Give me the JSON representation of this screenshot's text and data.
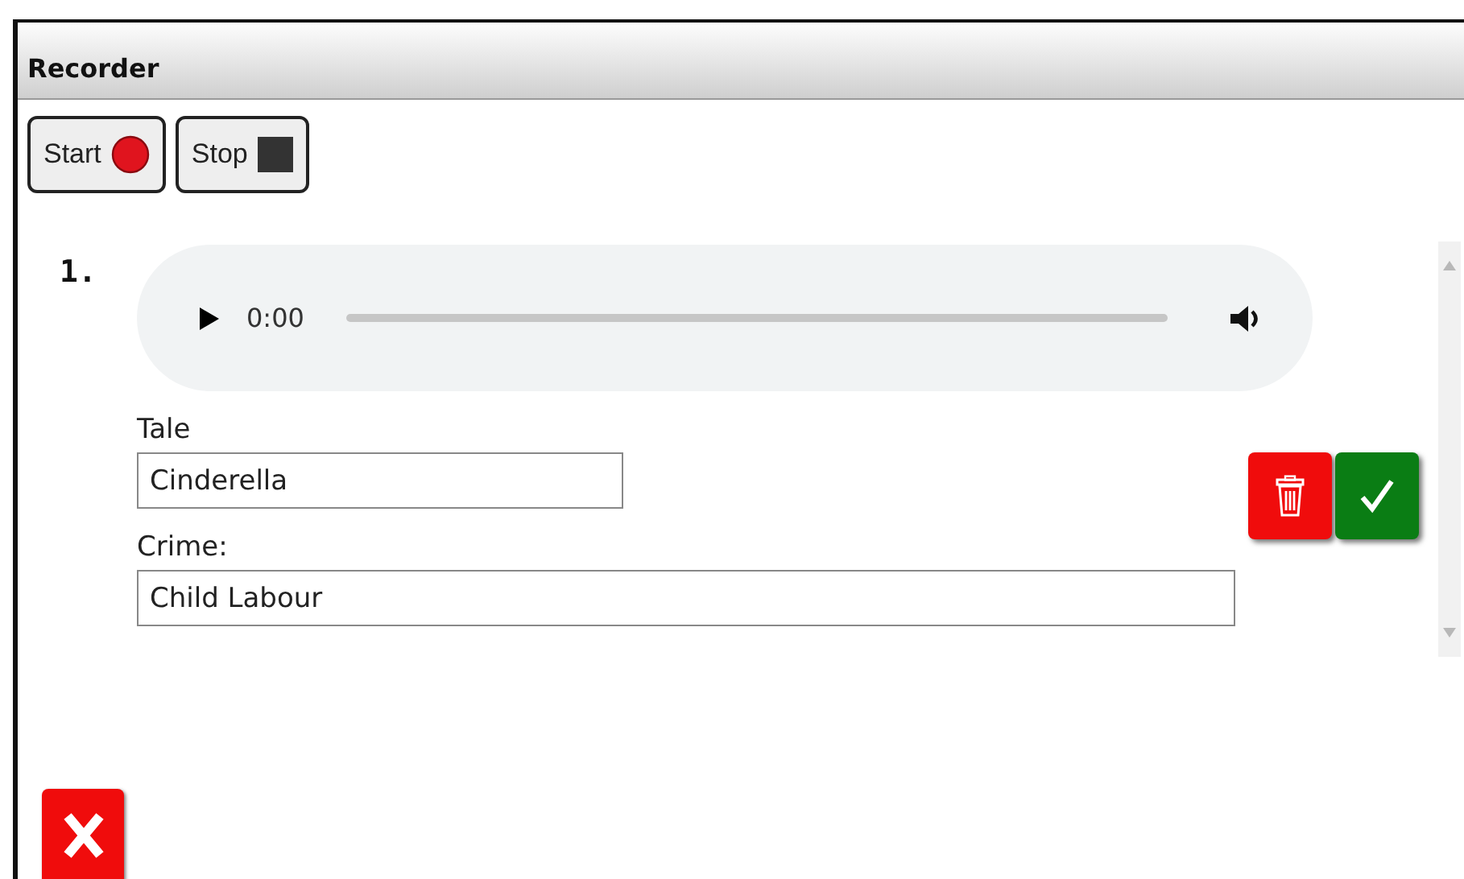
{
  "window": {
    "title": "Recorder"
  },
  "toolbar": [
    {
      "label": "Start",
      "kind": "record"
    },
    {
      "label": "Stop",
      "kind": "stop"
    }
  ],
  "recordings": [
    {
      "number": "1.",
      "player": {
        "time": "0:00"
      },
      "fields": [
        {
          "label": "Tale",
          "value": "Cinderella",
          "kind": "short"
        },
        {
          "label": "Crime:",
          "value": "Child Labour",
          "kind": "long"
        }
      ]
    }
  ]
}
